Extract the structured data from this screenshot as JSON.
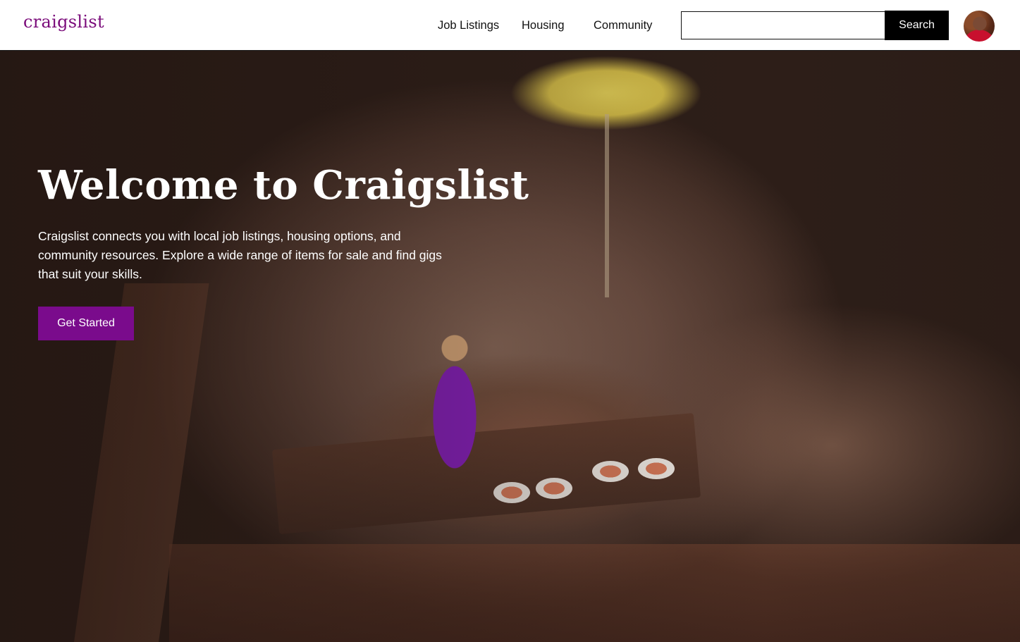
{
  "header": {
    "logo": "craigslist",
    "nav": [
      "Job Listings",
      "Housing",
      "Community"
    ],
    "search": {
      "value": "",
      "placeholder": "",
      "button_label": "Search"
    },
    "avatar": "user-avatar"
  },
  "hero": {
    "title": "Welcome to Craigslist",
    "description": "Craigslist connects you with local job listings, housing options, and community resources. Explore a wide range of items for sale and find gigs that suit your skills.",
    "cta_label": "Get Started",
    "background": "photo-miniature-figures-dining"
  },
  "colors": {
    "brand": "#7a0b7a",
    "cta": "#7a0b8c",
    "search_button": "#000000"
  }
}
